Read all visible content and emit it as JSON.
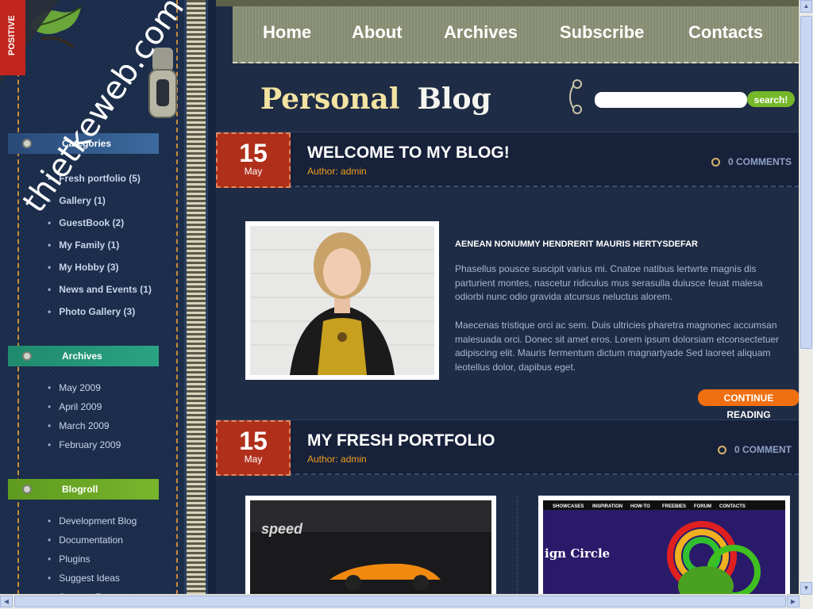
{
  "nav": {
    "items": [
      "Home",
      "About",
      "Archives",
      "Subscribe",
      "Contacts"
    ]
  },
  "logo": {
    "part1": "Personal",
    "part2": "Blog"
  },
  "search": {
    "button": "search!",
    "value": ""
  },
  "badge": {
    "label": "POSITIVE"
  },
  "watermark": {
    "text": "thietkeweb.com"
  },
  "sidebar": {
    "categories_title": "Categories",
    "categories": [
      "Fresh portfolio (5)",
      "Gallery (1)",
      "GuestBook (2)",
      "My Family (1)",
      "My Hobby (3)",
      "News and Events (1)",
      "Photo Gallery (3)"
    ],
    "archives_title": "Archives",
    "archives": [
      "May 2009",
      "April 2009",
      "March 2009",
      "February 2009"
    ],
    "blogroll_title": "Blogroll",
    "blogroll": [
      "Development Blog",
      "Documentation",
      "Plugins",
      "Suggest Ideas",
      "Support Forum"
    ]
  },
  "posts": [
    {
      "day": "15",
      "month": "May",
      "title": "WELCOME TO MY BLOG!",
      "author": "Author: admin",
      "comments": "0 COMMENTS",
      "heading": "AENEAN NONUMMY HENDRERIT MAURIS HERTYSDEFAR",
      "para1": "Phasellus pousce suscipit varius mi. Cnatoe natibus lertwrte magnis dis parturient montes, nascetur ridiculus mus serasulla duiusce feuat malesa odiorbi nunc odio gravida atcursus neluctus alorem.",
      "para2": "Maecenas tristique orci ac sem. Duis ultricies pharetra magnonec accumsan malesuada orci. Donec sit amet eros. Lorem ipsum dolorsiam etconsectetuer adipiscing elit. Mauris fermentum dictum magnartyade Sed laoreet aliquam leotellus dolor, dapibus eget.",
      "continue": "CONTINUE READING"
    },
    {
      "day": "15",
      "month": "May",
      "title": "MY FRESH PORTFOLIO",
      "author": "Author: admin",
      "comments": "0 COMMENT"
    }
  ],
  "thumbs": {
    "speed_text": "speed",
    "design_text": "ign Circle",
    "menu": [
      "SHOWCASES",
      "INSPIRATION",
      "HOW-TO",
      "FREEBIES",
      "FORUM",
      "CONTACTS"
    ]
  }
}
